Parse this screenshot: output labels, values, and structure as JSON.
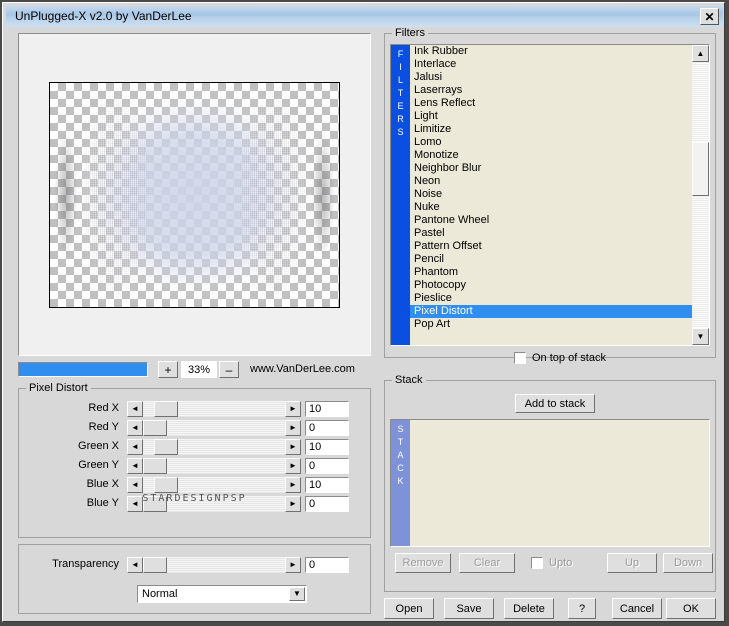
{
  "window": {
    "title": "UnPlugged-X v2.0 by VanDerLee",
    "close_label": "✕"
  },
  "preview": {
    "zoom_percent": "33%",
    "zoom_in_label": "+",
    "zoom_out_label": "–",
    "website": "www.VanDerLee.com"
  },
  "filters": {
    "legend": "Filters",
    "strip_label": "FILTERS",
    "selected": "Pixel Distort",
    "items": [
      "Ink Rubber",
      "Interlace",
      "Jalusi",
      "Laserrays",
      "Lens Reflect",
      "Light",
      "Limitize",
      "Lomo",
      "Monotize",
      "Neighbor Blur",
      "Neon",
      "Noise",
      "Nuke",
      "Pantone Wheel",
      "Pastel",
      "Pattern Offset",
      "Pencil",
      "Phantom",
      "Photocopy",
      "Pieslice",
      "Pixel Distort",
      "Pop Art"
    ],
    "on_top_label": "On top of stack",
    "scroll_up_label": "▲",
    "scroll_down_label": "▼"
  },
  "pixel_distort": {
    "legend": "Pixel Distort",
    "watermark": "STARDESIGNPSP",
    "left_arrow": "◄",
    "right_arrow": "►",
    "sliders": [
      {
        "label": "Red X",
        "value": "10"
      },
      {
        "label": "Red Y",
        "value": "0"
      },
      {
        "label": "Green X",
        "value": "10"
      },
      {
        "label": "Green Y",
        "value": "0"
      },
      {
        "label": "Blue X",
        "value": "10"
      },
      {
        "label": "Blue Y",
        "value": "0"
      }
    ]
  },
  "transparency": {
    "label": "Transparency",
    "value": "0",
    "blend_mode": "Normal",
    "dropdown_arrow": "▼"
  },
  "stack": {
    "legend": "Stack",
    "strip_label": "STACK",
    "add_label": "Add to stack",
    "remove_label": "Remove",
    "clear_label": "Clear",
    "upto_label": "Upto",
    "up_label": "Up",
    "down_label": "Down",
    "items": []
  },
  "bottom_buttons": {
    "open": "Open",
    "save": "Save",
    "delete": "Delete",
    "help": "?",
    "cancel": "Cancel",
    "ok": "OK"
  },
  "colors": {
    "title_bar": "#a8c6e6",
    "selection": "#2f8ef0",
    "filters_strip": "#0a4fe0",
    "stack_strip": "#7d92d8",
    "listbox_bg": "#ece9d8",
    "dialog_bg": "#d8d8d8"
  }
}
